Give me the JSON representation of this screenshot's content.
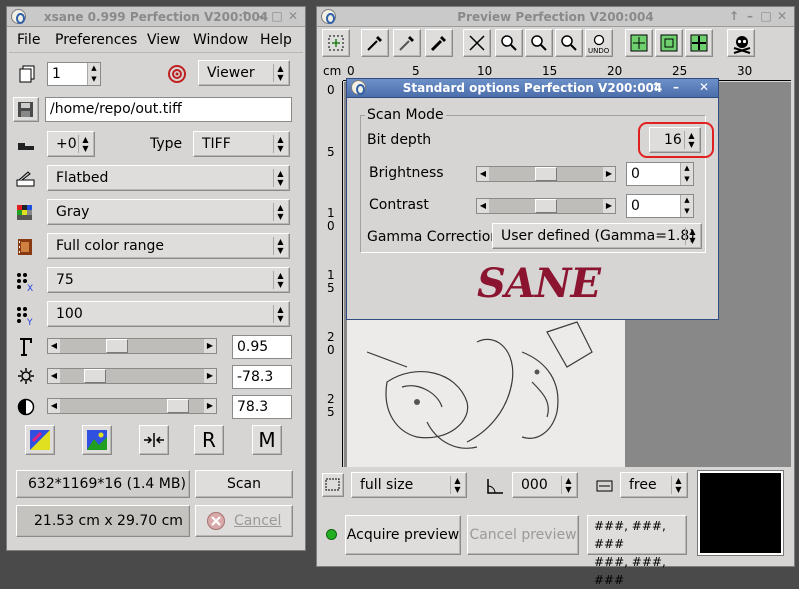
{
  "left_window": {
    "title": "xsane 0.999 Perfection V200:004",
    "menu": [
      "File",
      "Preferences",
      "View",
      "Window",
      "Help"
    ],
    "copies_value": "1",
    "viewer_label": "Viewer",
    "filename": "/home/repo/out.tiff",
    "increment_value": "+0",
    "type_label": "Type",
    "type_value": "TIFF",
    "source_value": "Flatbed",
    "color_mode": "Gray",
    "medium_value": "Full color range",
    "resolution_x": "75",
    "resolution_y": "100",
    "gamma_value": "0.95",
    "brightness_value": "-78.3",
    "contrast_value": "78.3",
    "image_info": "632*1169*16 (1.4 MB)",
    "scan_label": "Scan",
    "size_info": "21.53 cm x 29.70 cm",
    "cancel_label": "Cancel",
    "gamma_slider_level": 0.38,
    "brightness_slider_level": 0.2,
    "contrast_slider_level": 0.88,
    "letter_r": "R",
    "letter_m": "M"
  },
  "preview_window": {
    "title": "Preview Perfection V200:004",
    "ruler_unit": "cm",
    "ruler_top_labels": [
      "0",
      "5",
      "10",
      "15",
      "20",
      "25",
      "30"
    ],
    "ruler_left_labels": [
      "0",
      "5",
      "10",
      "15",
      "20",
      "25"
    ],
    "undo_label": "UNDO",
    "zoom_value": "full size",
    "rotation_value": "000",
    "ratio_value": "free",
    "acquire_label": "Acquire preview",
    "cancel_preview_label": "Cancel preview",
    "color_readout_1": "###, ###, ###",
    "color_readout_2": "###, ###, ###"
  },
  "options_dialog": {
    "title": "Standard options Perfection V200:004",
    "group_label": "Scan Mode",
    "bit_depth_label": "Bit depth",
    "bit_depth_value": "16",
    "brightness_label": "Brightness",
    "brightness_value": "0",
    "contrast_label": "Contrast",
    "contrast_value": "0",
    "gamma_label": "Gamma Correction",
    "gamma_value": "User defined (Gamma=1.8)",
    "logo_text": "SANE",
    "brightness_slider_level": 0.5,
    "contrast_slider_level": 0.5
  },
  "colors": {
    "highlight": "#e02020",
    "logo": "#8b1430",
    "status_led": "#22b022",
    "title_active": "#5a7fbc"
  }
}
